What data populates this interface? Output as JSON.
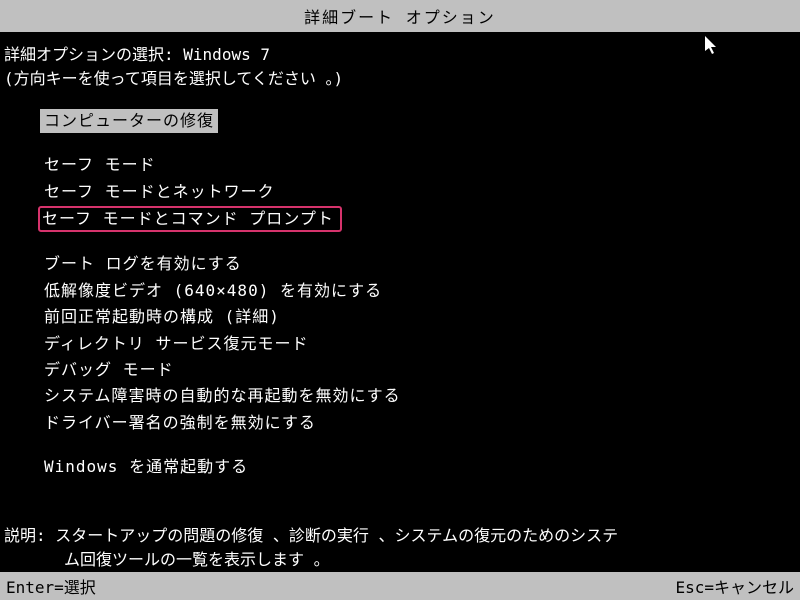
{
  "title": "詳細ブート  オプション",
  "header": {
    "choose_label": "詳細オプションの選択:",
    "os_name": "Windows 7",
    "instruction": "(方向キーを使って項目を選択してください 。)"
  },
  "menu": {
    "group1": [
      "コンピューターの修復"
    ],
    "group2": [
      "セーフ モード",
      "セーフ モードとネットワーク",
      "セーフ モードとコマンド プロンプト"
    ],
    "group3": [
      "ブート ログを有効にする",
      "低解像度ビデオ (640×480) を有効にする",
      "前回正常起動時の構成 (詳細)",
      "ディレクトリ サービス復元モード",
      "デバッグ モード",
      "システム障害時の自動的な再起動を無効にする",
      "ドライバー署名の強制を無効にする"
    ],
    "group4": [
      "Windows を通常起動する"
    ]
  },
  "description": {
    "label": "説明:",
    "text_line1": "スタートアップの問題の修復 、診断の実行 、システムの復元のためのシステ",
    "text_line2": "ム回復ツールの一覧を表示します 。"
  },
  "footer": {
    "enter": "Enter=選択",
    "esc": "Esc=キャンセル"
  }
}
